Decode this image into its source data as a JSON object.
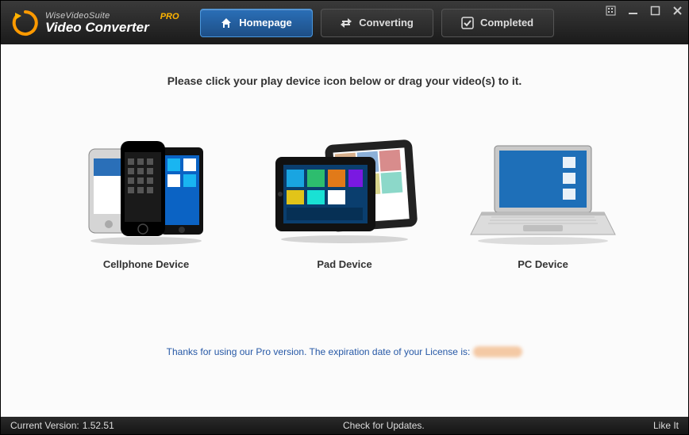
{
  "app": {
    "suite": "WiseVideoSuite",
    "title": "Video Converter",
    "badge": "PRO"
  },
  "tabs": {
    "homepage": "Homepage",
    "converting": "Converting",
    "completed": "Completed"
  },
  "main": {
    "instruction": "Please click your play device icon below or drag your video(s) to it."
  },
  "devices": {
    "cellphone": "Cellphone Device",
    "pad": "Pad Device",
    "pc": "PC Device"
  },
  "license": {
    "prefix": "Thanks for using our Pro version. The expiration date of your License is:"
  },
  "status": {
    "version_label": "Current Version:",
    "version_value": "1.52.51",
    "check_updates": "Check for Updates.",
    "like_it": "Like It"
  }
}
